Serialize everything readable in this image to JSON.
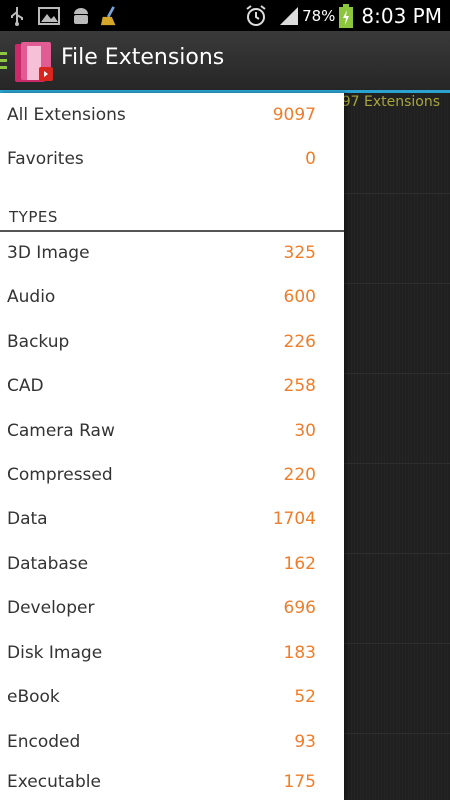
{
  "status_bar": {
    "battery_percent": "78%",
    "time": "8:03 PM",
    "icons": [
      "usb-icon",
      "image-icon",
      "android-debug-icon",
      "cleaner-broom-icon",
      "alarm-icon",
      "signal-icon",
      "battery-charging-icon"
    ]
  },
  "action_bar": {
    "title": "File Extensions"
  },
  "background": {
    "extensions_header": "97 Extensions"
  },
  "drawer": {
    "top_items": [
      {
        "label": "All Extensions",
        "count": "9097"
      },
      {
        "label": "Favorites",
        "count": "0"
      }
    ],
    "section_title": "TYPES",
    "types": [
      {
        "label": "3D Image",
        "count": "325"
      },
      {
        "label": "Audio",
        "count": "600"
      },
      {
        "label": "Backup",
        "count": "226"
      },
      {
        "label": "CAD",
        "count": "258"
      },
      {
        "label": "Camera Raw",
        "count": "30"
      },
      {
        "label": "Compressed",
        "count": "220"
      },
      {
        "label": "Data",
        "count": "1704"
      },
      {
        "label": "Database",
        "count": "162"
      },
      {
        "label": "Developer",
        "count": "696"
      },
      {
        "label": "Disk Image",
        "count": "183"
      },
      {
        "label": "eBook",
        "count": "52"
      },
      {
        "label": "Encoded",
        "count": "93"
      },
      {
        "label": "Executable",
        "count": "175"
      }
    ]
  },
  "colors": {
    "accent_blue": "#2aa3d1",
    "count_orange": "#ef7d2a",
    "header_olive": "#a8a63a",
    "drawer_indicator_green": "#8cc63f"
  }
}
